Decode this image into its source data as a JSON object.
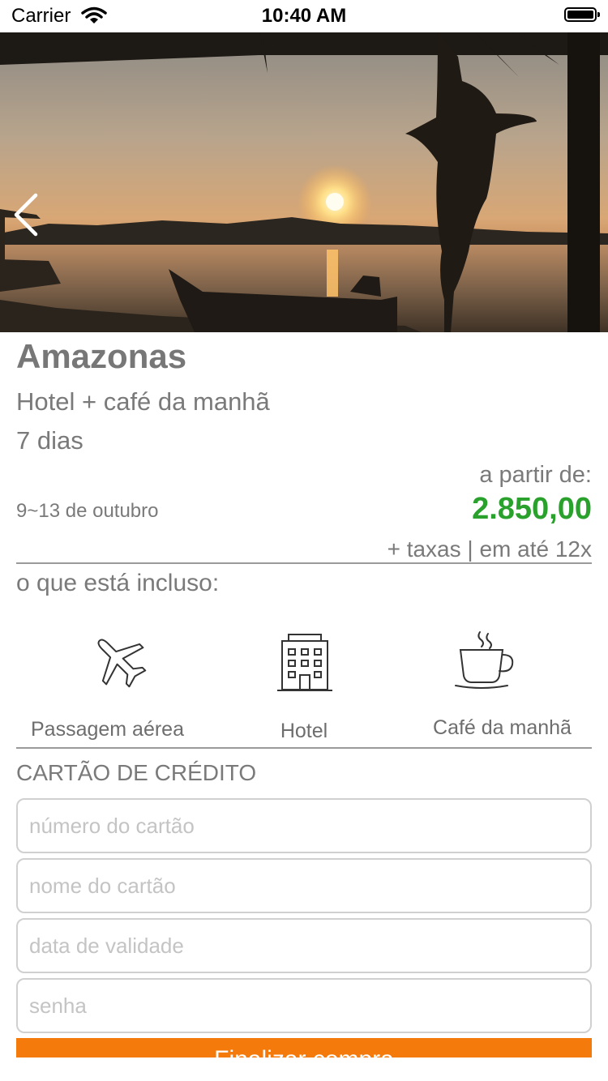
{
  "status_bar": {
    "carrier": "Carrier",
    "time": "10:40 AM"
  },
  "hero": {
    "back_icon": "chevron-left-icon"
  },
  "package": {
    "destination": "Amazonas",
    "plan": "Hotel + café da manhã",
    "duration": "7 dias",
    "price_prefix": "a partir de:",
    "dates": "9~13 de outubro",
    "price": "2.850,00",
    "price_suffix": "+ taxas | em até 12x",
    "price_color": "#2aa12c"
  },
  "included": {
    "heading": "o que está incluso:",
    "items": [
      {
        "label": "Passagem aérea",
        "icon": "airplane-icon"
      },
      {
        "label": "Hotel",
        "icon": "hotel-icon"
      },
      {
        "label": "Café da manhã",
        "icon": "coffee-cup-icon"
      }
    ]
  },
  "payment": {
    "heading": "CARTÃO DE CRÉDITO",
    "fields": [
      {
        "placeholder": "número do cartão",
        "value": ""
      },
      {
        "placeholder": "nome do cartão",
        "value": ""
      },
      {
        "placeholder": "data de validade",
        "value": ""
      },
      {
        "placeholder": "senha",
        "value": ""
      }
    ],
    "submit_label": "Finalizar compra",
    "accent_color": "#f47a0b"
  }
}
